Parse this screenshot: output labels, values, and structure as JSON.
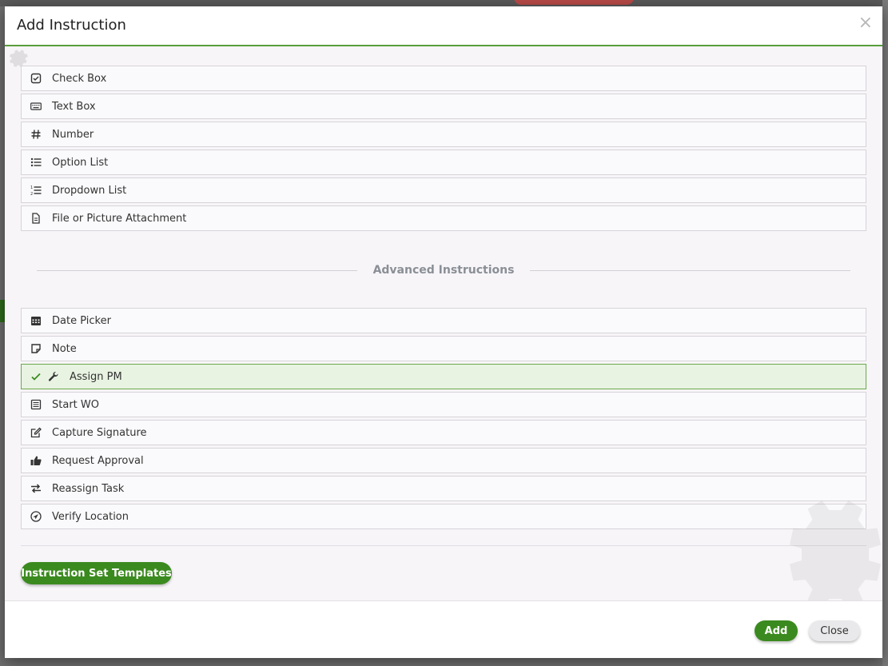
{
  "dialog": {
    "title": "Add Instruction",
    "close_glyph": "×"
  },
  "basic_instructions": [
    {
      "label": "Check Box",
      "icon": "checkbox-icon"
    },
    {
      "label": "Text Box",
      "icon": "keyboard-icon"
    },
    {
      "label": "Number",
      "icon": "hash-icon"
    },
    {
      "label": "Option List",
      "icon": "list-icon"
    },
    {
      "label": "Dropdown List",
      "icon": "ordered-list-icon"
    },
    {
      "label": "File or Picture Attachment",
      "icon": "file-icon"
    }
  ],
  "advanced_header": "Advanced Instructions",
  "advanced_instructions": [
    {
      "label": "Date Picker",
      "icon": "calendar-icon",
      "selected": false
    },
    {
      "label": "Note",
      "icon": "note-icon",
      "selected": false
    },
    {
      "label": "Assign PM",
      "icon": "wrench-icon",
      "selected": true
    },
    {
      "label": "Start WO",
      "icon": "work-order-icon",
      "selected": false
    },
    {
      "label": "Capture Signature",
      "icon": "edit-icon",
      "selected": false
    },
    {
      "label": "Request Approval",
      "icon": "thumbs-up-icon",
      "selected": false
    },
    {
      "label": "Reassign Task",
      "icon": "exchange-icon",
      "selected": false
    },
    {
      "label": "Verify Location",
      "icon": "location-arrow-icon",
      "selected": false
    }
  ],
  "buttons": {
    "templates": "Instruction Set Templates",
    "add": "Add",
    "close": "Close"
  },
  "colors": {
    "accent_green": "#3b8a1f",
    "header_rule": "#5a9e3a",
    "selected_bg": "#e8f3e2",
    "selected_border": "#6aaa4c"
  }
}
